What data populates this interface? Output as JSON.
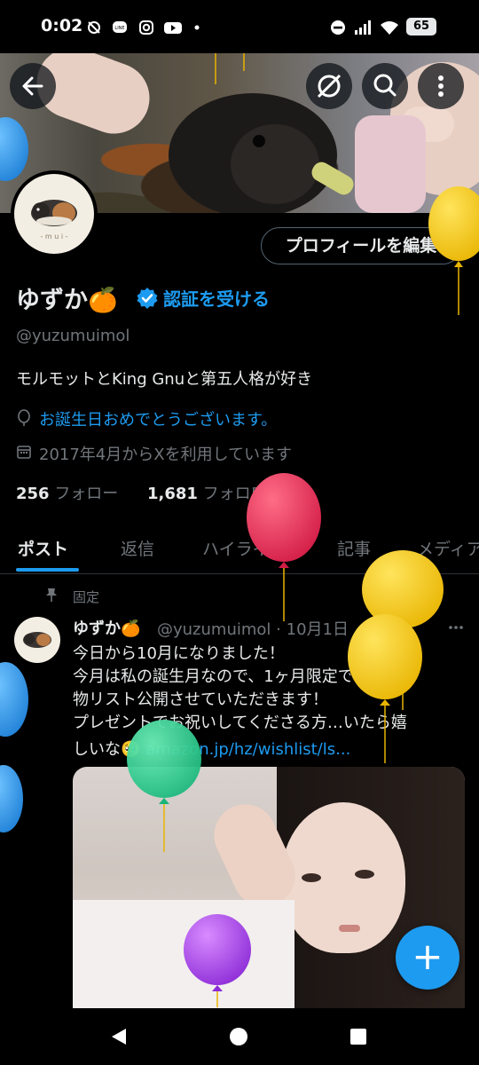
{
  "status_bar": {
    "time": "0:02",
    "battery": "65",
    "icons": [
      "sync-icon",
      "line-icon",
      "instagram-icon",
      "youtube-icon",
      "dot-icon",
      "dnd-icon",
      "signal-icon",
      "wifi-icon",
      "battery-icon"
    ]
  },
  "header": {
    "back_icon": "arrow-left-icon",
    "action_icons": [
      "no-sync-icon",
      "search-icon",
      "more-vertical-icon"
    ]
  },
  "profile": {
    "edit_label": "プロフィールを編集",
    "display_name": "ゆずか🍊",
    "verify_label": "認証を受ける",
    "handle": "@yuzumuimol",
    "bio": "モルモットとKing Gnuと第五人格が好き",
    "birthday_text": "お誕生日おめでとうございます。",
    "joined_text": "2017年4月からXを利用しています",
    "following_count": "256",
    "following_label": "フォロー",
    "followers_count": "1,681",
    "followers_label": "フォロワー",
    "avatar_caption": "- m u i -"
  },
  "tabs": [
    {
      "label": "ポスト",
      "active": true
    },
    {
      "label": "返信",
      "active": false
    },
    {
      "label": "ハイライト",
      "active": false
    },
    {
      "label": "記事",
      "active": false
    },
    {
      "label": "メディア",
      "active": false
    }
  ],
  "post": {
    "pinned_label": "固定",
    "author_name": "ゆずか🍊",
    "author_handle": "@yuzumuimol",
    "date": "10月1日",
    "lines": [
      "今日から10月になりました！",
      "今月は私の誕生月なので、1ヶ月限定でほしい",
      "物リスト公開させていただきます！",
      "プレゼントでお祝いしてくださる方…いたら嬉"
    ],
    "last_line_prefix": "しいな🥺 ",
    "link_text": "amazon.jp/hz/wishlist/ls..."
  },
  "fab_label": "+",
  "colors": {
    "accent": "#1d9bf0",
    "text": "#e7e9ea",
    "muted": "#71767b",
    "background": "#000000"
  },
  "balloons": [
    "blue",
    "blue",
    "yellow",
    "red",
    "yellow",
    "yellow",
    "green",
    "blue",
    "blue",
    "purple"
  ]
}
